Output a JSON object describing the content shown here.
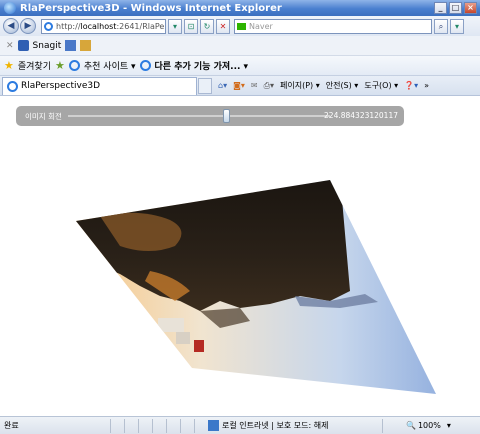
{
  "window": {
    "title": "RlaPerspective3D - Windows Internet Explorer",
    "min": "_",
    "max": "□",
    "close": "×"
  },
  "address": {
    "prefix": "http://",
    "host": "localhost",
    "rest": ":2641/RlaPers",
    "search_placeholder": "Naver"
  },
  "commands": {
    "snagit": "Snagit"
  },
  "favorites": {
    "label": "즐겨찾기",
    "suggested": "추천 사이트 ▾",
    "more": "다른 추가 기능 가져... ▾"
  },
  "tab": {
    "title": "RlaPerspective3D"
  },
  "toolbar": {
    "page": "페이지(P) ▾",
    "safety": "안전(S) ▾",
    "tools": "도구(O) ▾"
  },
  "slider": {
    "label": "이미지 회전",
    "value": "224.884323120117",
    "fraction": 0.8
  },
  "status": {
    "done": "완료",
    "zone": "로컬 인트라넷 | 보호 모드: 해제",
    "zoom": "100%"
  },
  "colors": {
    "title_start": "#8fb4e8",
    "title_end": "#3b6fbf",
    "panel": "#a6a6a6"
  }
}
